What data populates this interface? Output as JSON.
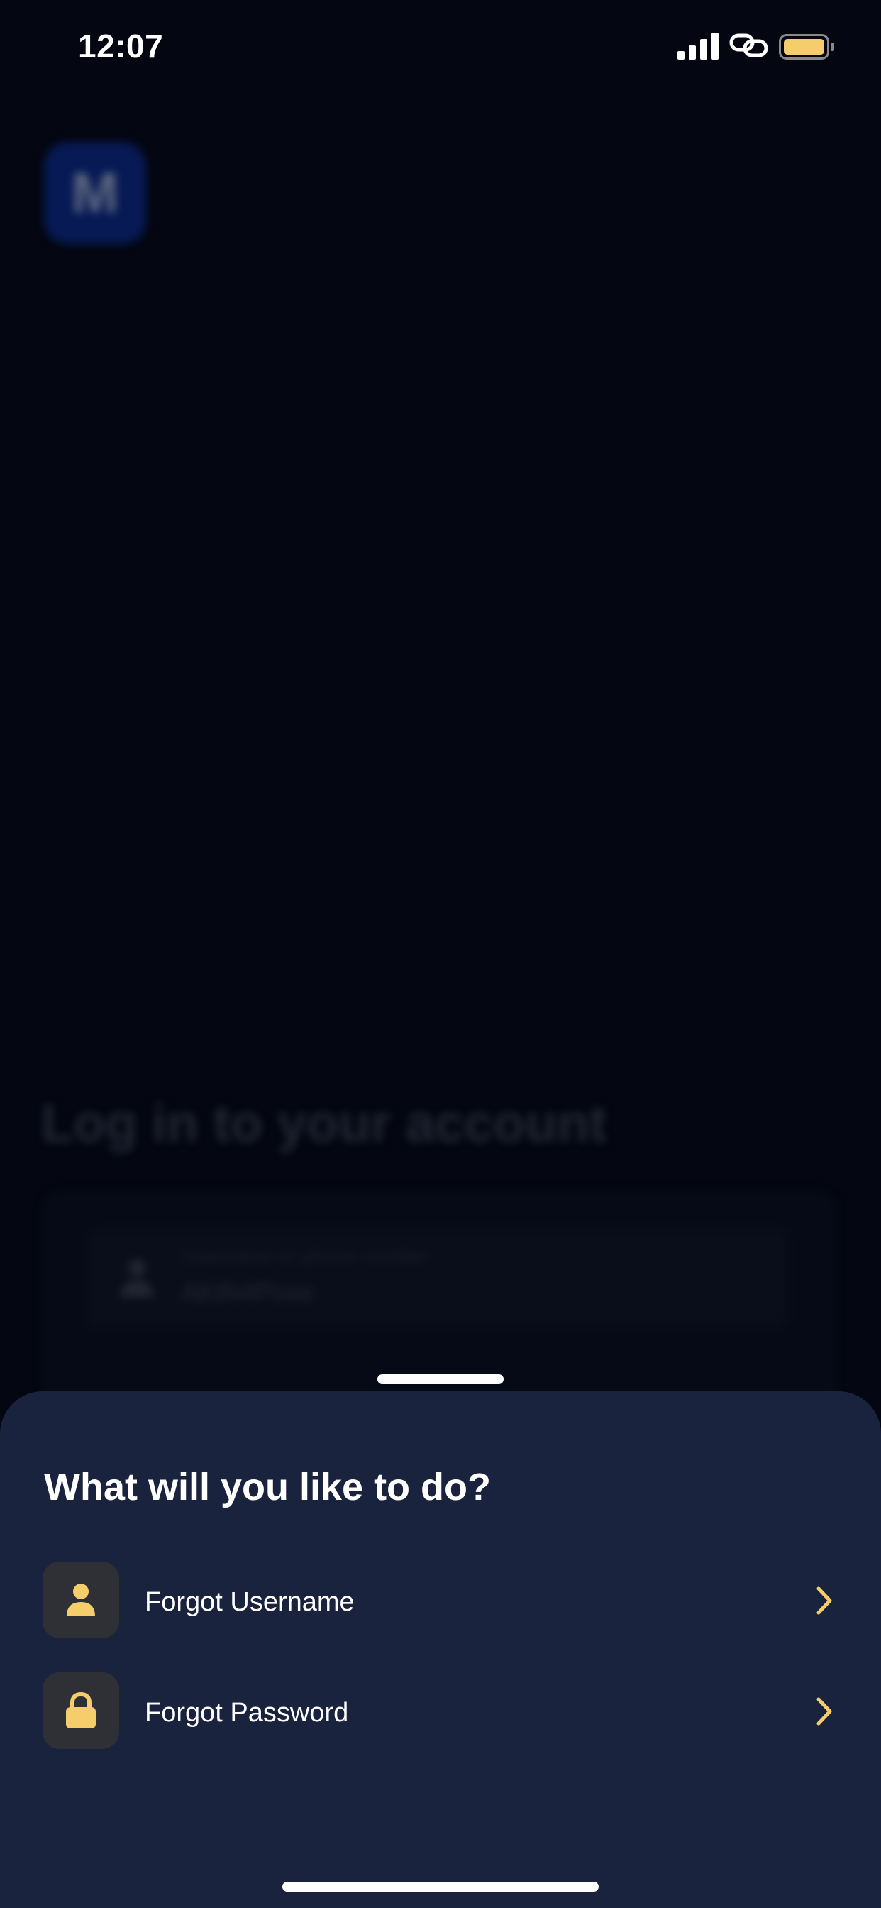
{
  "status_bar": {
    "time": "12:07"
  },
  "colors": {
    "accent": "#F5CE6B",
    "sheet_background": "#1A233D",
    "page_background": "#040712",
    "icon_box": "#2E3036"
  },
  "background_screen": {
    "logo_letter": "M",
    "title": "Log in to your account",
    "username_field": {
      "label": "Username or phone number",
      "value": "AKIN4Pose"
    }
  },
  "sheet": {
    "title": "What will you like to do?",
    "options": [
      {
        "label": "Forgot Username",
        "icon": "person-icon"
      },
      {
        "label": "Forgot Password",
        "icon": "lock-icon"
      }
    ]
  }
}
